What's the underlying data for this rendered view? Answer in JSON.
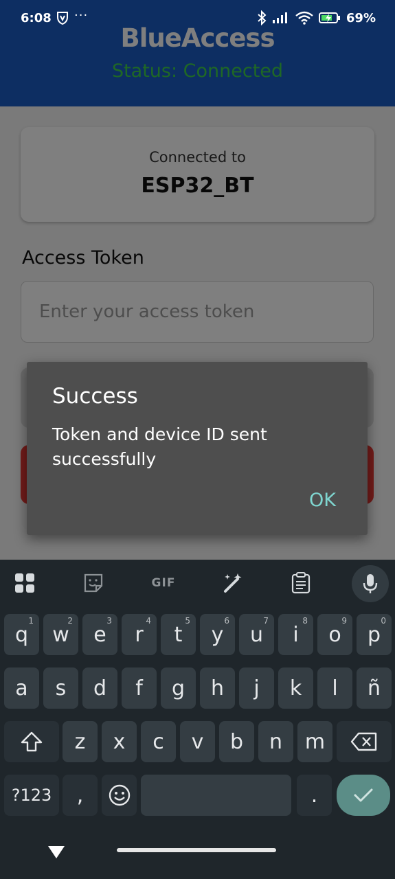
{
  "status_bar": {
    "time": "6:08",
    "more": "···",
    "battery": "69%"
  },
  "app": {
    "title": "BlueAccess",
    "status": "Status: Connected",
    "connected_label": "Connected to",
    "device_name": "ESP32_BT",
    "token_label": "Access Token",
    "token_placeholder": "Enter your access token"
  },
  "dialog": {
    "title": "Success",
    "message": "Token and device ID sent successfully",
    "ok_label": "OK"
  },
  "keyboard": {
    "toolbar": {
      "gif_label": "GIF"
    },
    "row1": [
      {
        "k": "q",
        "h": "1"
      },
      {
        "k": "w",
        "h": "2"
      },
      {
        "k": "e",
        "h": "3"
      },
      {
        "k": "r",
        "h": "4"
      },
      {
        "k": "t",
        "h": "5"
      },
      {
        "k": "y",
        "h": "6"
      },
      {
        "k": "u",
        "h": "7"
      },
      {
        "k": "i",
        "h": "8"
      },
      {
        "k": "o",
        "h": "9"
      },
      {
        "k": "p",
        "h": "0"
      }
    ],
    "row2": [
      "a",
      "s",
      "d",
      "f",
      "g",
      "h",
      "j",
      "k",
      "l",
      "ñ"
    ],
    "row3": [
      "z",
      "x",
      "c",
      "v",
      "b",
      "n",
      "m"
    ],
    "symbols_label": "?123",
    "comma": ",",
    "period": "."
  },
  "colors": {
    "header": "#1a5dc4",
    "status_green": "#3fd14a",
    "dialog_bg": "#4e4e4e",
    "ok_accent": "#7fd6d0",
    "keyboard_bg": "#1f262b",
    "enter_key": "#5b8d87"
  }
}
